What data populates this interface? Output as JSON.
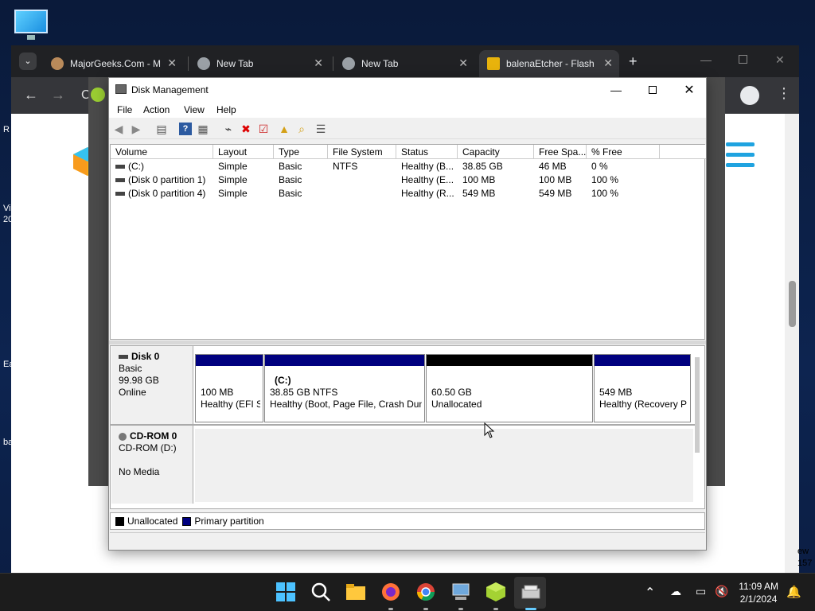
{
  "browser": {
    "tabs": [
      {
        "label": "MajorGeeks.Com - M",
        "close": "✕"
      },
      {
        "label": "New Tab",
        "close": "✕"
      },
      {
        "label": "New Tab",
        "close": "✕"
      },
      {
        "label": "balenaEtcher - Flash",
        "close": "✕"
      }
    ],
    "new_tab": "+",
    "address_fragment": "C",
    "left_fragments": [
      "R",
      "Vi",
      "20",
      "Ea",
      "ba"
    ],
    "right_fragments": [
      "ew",
      "157"
    ]
  },
  "disk_management": {
    "title": "Disk Management",
    "menu": [
      "File",
      "Action",
      "View",
      "Help"
    ],
    "columns": [
      "Volume",
      "Layout",
      "Type",
      "File System",
      "Status",
      "Capacity",
      "Free Spa...",
      "% Free"
    ],
    "rows": [
      [
        "(C:)",
        "Simple",
        "Basic",
        "NTFS",
        "Healthy (B...",
        "38.85 GB",
        "46 MB",
        "0 %"
      ],
      [
        "(Disk 0 partition 1)",
        "Simple",
        "Basic",
        "",
        "Healthy (E...",
        "100 MB",
        "100 MB",
        "100 %"
      ],
      [
        "(Disk 0 partition 4)",
        "Simple",
        "Basic",
        "",
        "Healthy (R...",
        "549 MB",
        "549 MB",
        "100 %"
      ]
    ],
    "disk0": {
      "name": "Disk 0",
      "type": "Basic",
      "size": "99.98 GB",
      "state": "Online",
      "partitions": [
        {
          "title": "",
          "line1": "100 MB",
          "line2": "Healthy (EFI S"
        },
        {
          "title": "(C:)",
          "line1": "38.85 GB NTFS",
          "line2": "Healthy (Boot, Page File, Crash Dun"
        },
        {
          "title": "",
          "line1": "60.50 GB",
          "line2": "Unallocated"
        },
        {
          "title": "",
          "line1": "549 MB",
          "line2": "Healthy (Recovery P"
        }
      ]
    },
    "cdrom": {
      "name": "CD-ROM 0",
      "drive": "CD-ROM (D:)",
      "media": "No Media"
    },
    "legend": {
      "unallocated": "Unallocated",
      "primary": "Primary partition"
    },
    "colors": {
      "primary": "#00007f",
      "unallocated": "#000000"
    }
  },
  "taskbar": {
    "time": "11:09 AM",
    "date": "2/1/2024"
  }
}
